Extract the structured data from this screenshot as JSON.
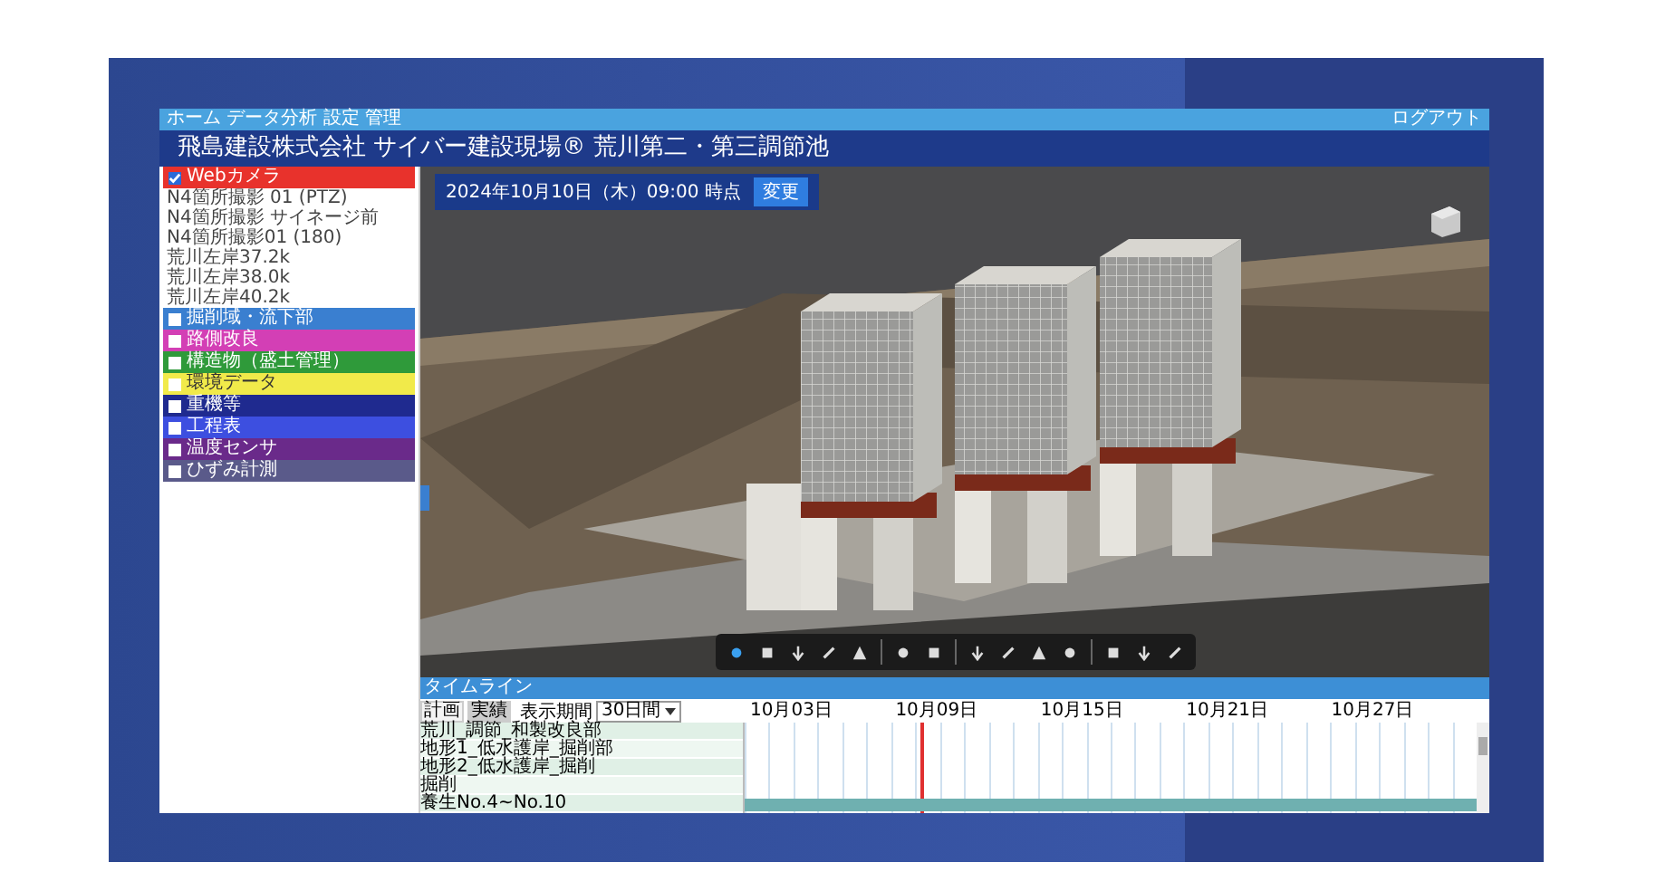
{
  "top_strip": {
    "menu": "ホーム データ分析 設定 管理",
    "logout": "ログアウト"
  },
  "title": "飛島建設株式会社 サイバー建設現場® 荒川第二・第三調節池",
  "layers": [
    {
      "label": "Webカメラ",
      "color": "#e8322c",
      "checked": true,
      "children": [
        {
          "label": "N4箇所撮影 01 (PTZ)"
        },
        {
          "label": "N4箇所撮影 サイネージ前"
        },
        {
          "label": "N4箇所撮影01 (180)"
        },
        {
          "label": "荒川左岸37.2k"
        },
        {
          "label": "荒川左岸38.0k"
        },
        {
          "label": "荒川左岸40.2k"
        }
      ]
    },
    {
      "label": "掘削域・流下部",
      "color": "#3a7fd0",
      "checked": false
    },
    {
      "label": "路側改良",
      "color": "#d33fb5",
      "checked": false
    },
    {
      "label": "構造物（盛土管理）",
      "color": "#2f9a3a",
      "checked": false
    },
    {
      "label": "環境データ",
      "color": "#f1ea4a",
      "checked": false
    },
    {
      "label": "重機等",
      "color": "#1f2a8f",
      "checked": false
    },
    {
      "label": "工程表",
      "color": "#3d4fe0",
      "checked": false
    },
    {
      "label": "温度センサ",
      "color": "#6a2a8a",
      "checked": false
    },
    {
      "label": "ひずみ計測",
      "color": "#5a5a8a",
      "checked": false
    }
  ],
  "viewer": {
    "date": "2024年10月10日（木）09:00 時点",
    "change_button": "変更",
    "tool_groups": [
      [
        {
          "selected": true
        },
        {
          "selected": false
        },
        {
          "selected": false
        },
        {
          "selected": false
        },
        {
          "selected": false
        }
      ],
      [
        {
          "selected": false
        },
        {
          "selected": false
        }
      ],
      [
        {
          "selected": false
        },
        {
          "selected": false
        },
        {
          "selected": false
        },
        {
          "selected": false
        }
      ],
      [
        {
          "selected": false
        },
        {
          "selected": false
        },
        {
          "selected": false
        }
      ]
    ]
  },
  "timeline": {
    "title": "タイムライン",
    "modes": [
      {
        "label": "計画",
        "selected": false
      },
      {
        "label": "実績",
        "selected": true
      }
    ],
    "period_label": "表示期間",
    "period_value": "30日間",
    "dates": [
      "10月03日",
      "10月09日",
      "10月15日",
      "10月21日",
      "10月27日"
    ],
    "rows": [
      {
        "label": "荒川_調節_和製改良部",
        "active": false
      },
      {
        "label": "地形1_低水護岸_掘削部",
        "active": false
      },
      {
        "label": "地形2_低水護岸_掘削",
        "active": false
      },
      {
        "label": "掘削",
        "active": false
      },
      {
        "label": "養生No.4~No.10",
        "active": true
      }
    ]
  }
}
